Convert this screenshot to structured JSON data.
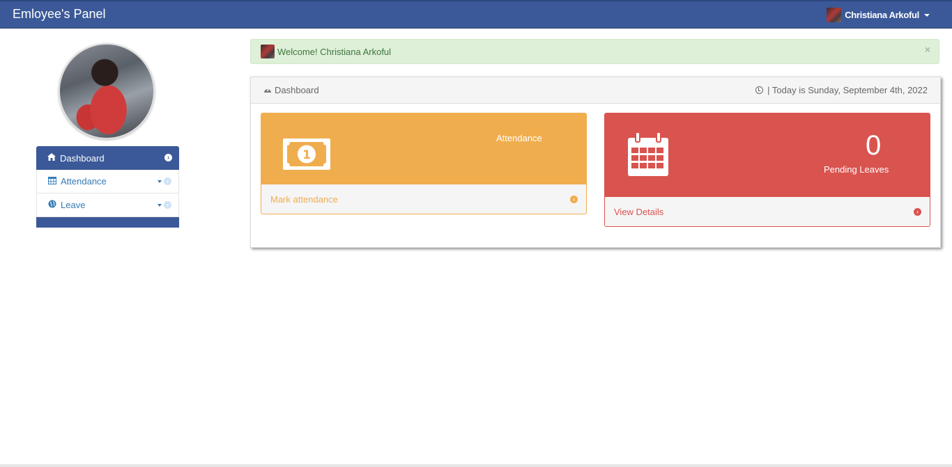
{
  "navbar": {
    "brand": "Emloyee's Panel",
    "user_name": "Christiana Arkoful"
  },
  "sidebar": {
    "items": [
      {
        "label": "Dashboard",
        "icon": "home-icon",
        "active": true
      },
      {
        "label": "Attendance",
        "icon": "calendar-icon",
        "active": false
      },
      {
        "label": "Leave",
        "icon": "globe-icon",
        "active": false
      }
    ]
  },
  "alert": {
    "message": "Welcome! Christiana Arkoful",
    "close": "×"
  },
  "panel": {
    "title": "Dashboard",
    "date_text": "| Today is Sunday, September 4th, 2022"
  },
  "cards": {
    "attendance": {
      "title": "Attendance",
      "link": "Mark attendance",
      "icon": "money-icon",
      "color": "#f0ad4e"
    },
    "leaves": {
      "count": "0",
      "title": "Pending Leaves",
      "link": "View Details",
      "icon": "calendar-icon",
      "color": "#d9534f"
    }
  },
  "colors": {
    "navbar": "#3b5998",
    "success_bg": "#dff0d8",
    "link": "#337ab7"
  }
}
